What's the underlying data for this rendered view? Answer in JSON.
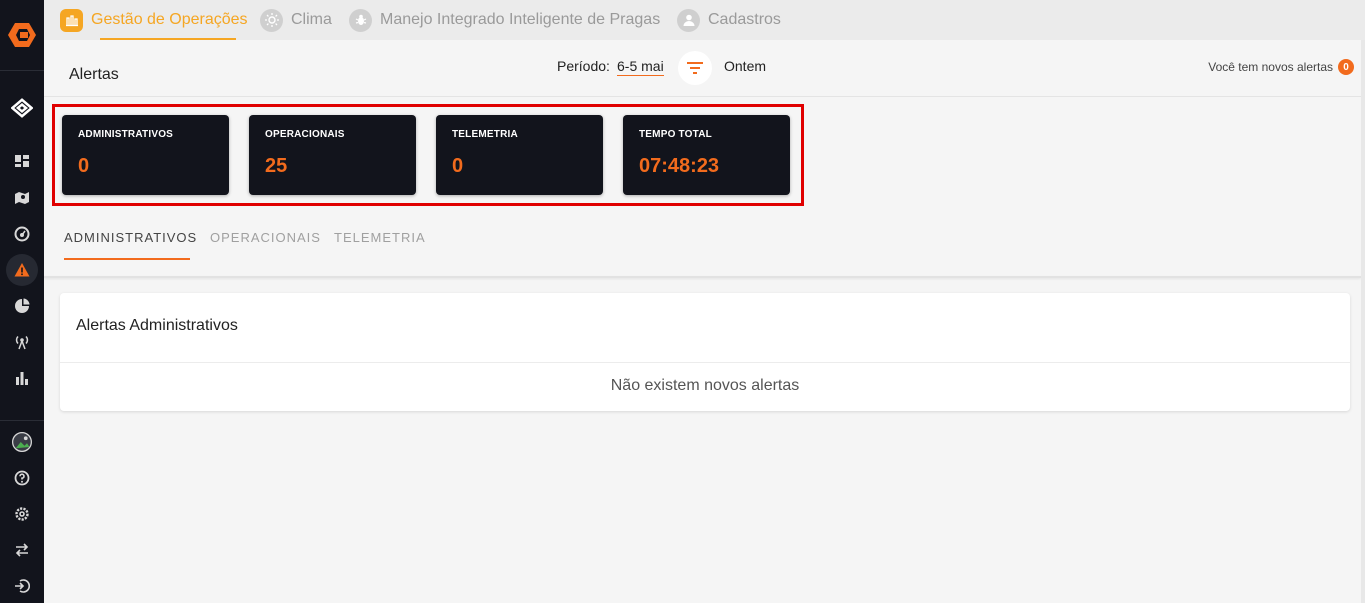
{
  "sidebar": {
    "items": [
      {
        "icon": "diamond-logo-icon"
      },
      {
        "icon": "dashboard-icon"
      },
      {
        "icon": "map-icon"
      },
      {
        "icon": "gauge-icon"
      },
      {
        "icon": "warning-icon"
      },
      {
        "icon": "pie-chart-icon"
      },
      {
        "icon": "antenna-icon"
      },
      {
        "icon": "bar-chart-icon"
      },
      {
        "icon": "avatar-icon"
      },
      {
        "icon": "help-icon"
      },
      {
        "icon": "settings-icon"
      },
      {
        "icon": "swap-icon"
      },
      {
        "icon": "logout-icon"
      }
    ]
  },
  "topnav": {
    "items": [
      {
        "label": "Gestão de Operações",
        "icon": "operations-icon"
      },
      {
        "label": "Clima",
        "icon": "sun-icon"
      },
      {
        "label": "Manejo Integrado Inteligente de Pragas",
        "icon": "bug-icon"
      },
      {
        "label": "Cadastros",
        "icon": "user-icon"
      }
    ]
  },
  "header": {
    "title": "Alertas",
    "periodo_label": "Período:",
    "periodo_value": "6-5 mai",
    "ontem": "Ontem",
    "alerts_note": "Você tem novos alertas",
    "alerts_count": "0"
  },
  "cards": [
    {
      "label": "ADMINISTRATIVOS",
      "value": "0"
    },
    {
      "label": "OPERACIONAIS",
      "value": "25"
    },
    {
      "label": "TELEMETRIA",
      "value": "0"
    },
    {
      "label": "TEMPO TOTAL",
      "value": "07:48:23"
    }
  ],
  "tabs": [
    {
      "label": "ADMINISTRATIVOS"
    },
    {
      "label": "OPERACIONAIS"
    },
    {
      "label": "TELEMETRIA"
    }
  ],
  "panel": {
    "title": "Alertas Administrativos",
    "empty": "Não existem novos alertas"
  },
  "colors": {
    "accent": "#f26b1d",
    "nav_active": "#f5a623",
    "sidebar_bg": "#12141c",
    "highlight_frame": "#e00000"
  }
}
